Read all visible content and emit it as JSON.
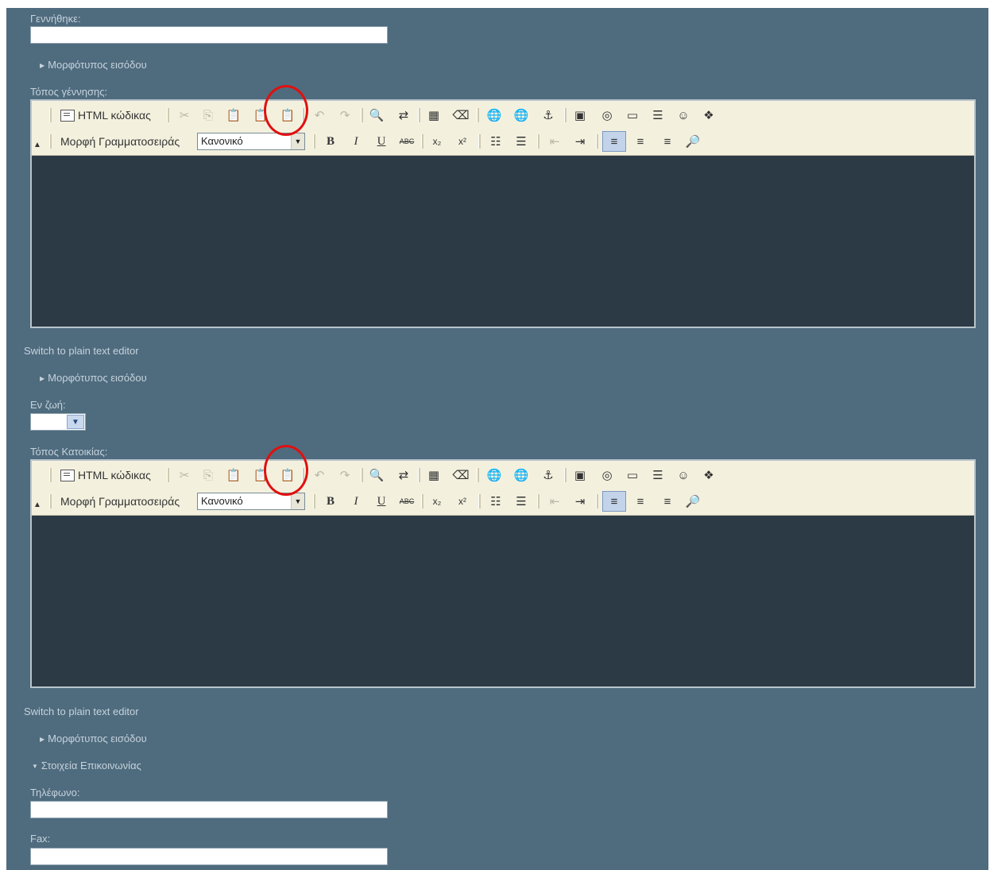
{
  "form": {
    "born_label": "Γεννήθηκε:",
    "born_value": "",
    "input_format_label": "Μορφότυπος εισόδου",
    "birthplace_label": "Τόπος γέννησης:",
    "switch_editor_label": "Switch to plain text editor",
    "alive_label": "Εν ζωή:",
    "alive_value": "",
    "residence_label": "Τόπος Κατοικίας:",
    "contact_section_label": "Στοιχεία Επικοινωνίας",
    "phone_label": "Τηλέφωνο:",
    "phone_value": "",
    "fax_label": "Fax:",
    "fax_value": ""
  },
  "editor": {
    "html_source_label": "HTML κώδικας",
    "font_format_label": "Μορφή Γραμματοσειράς",
    "font_format_value": "Κανονικό"
  },
  "colors": {
    "panel_bg": "#4f6b7e",
    "editor_bg": "#2c3a46",
    "toolbar_bg": "#f3f1de",
    "highlight_circle": "#e01010"
  }
}
